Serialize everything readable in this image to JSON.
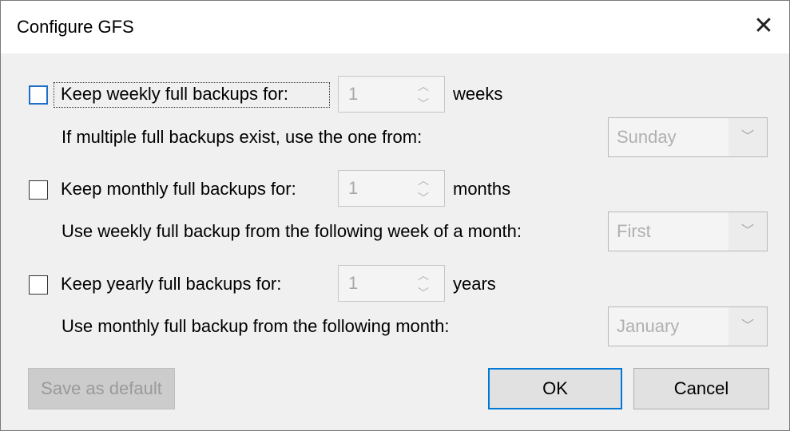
{
  "window": {
    "title": "Configure GFS",
    "close_icon": "close-icon"
  },
  "weekly": {
    "checkbox_label": "Keep weekly full backups for:",
    "checked": false,
    "value": "1",
    "unit": "weeks",
    "sub_label": "If multiple full backups exist, use the one from:",
    "select_value": "Sunday"
  },
  "monthly": {
    "checkbox_label": "Keep monthly full backups for:",
    "checked": false,
    "value": "1",
    "unit": "months",
    "sub_label": "Use weekly full backup from the following week of a month:",
    "select_value": "First"
  },
  "yearly": {
    "checkbox_label": "Keep yearly full backups for:",
    "checked": false,
    "value": "1",
    "unit": "years",
    "sub_label": "Use monthly full backup from the following month:",
    "select_value": "January"
  },
  "buttons": {
    "save_default": "Save as default",
    "ok": "OK",
    "cancel": "Cancel"
  },
  "icons": {
    "spin_up": "^",
    "spin_down": "v",
    "dropdown": "chevron-down"
  }
}
